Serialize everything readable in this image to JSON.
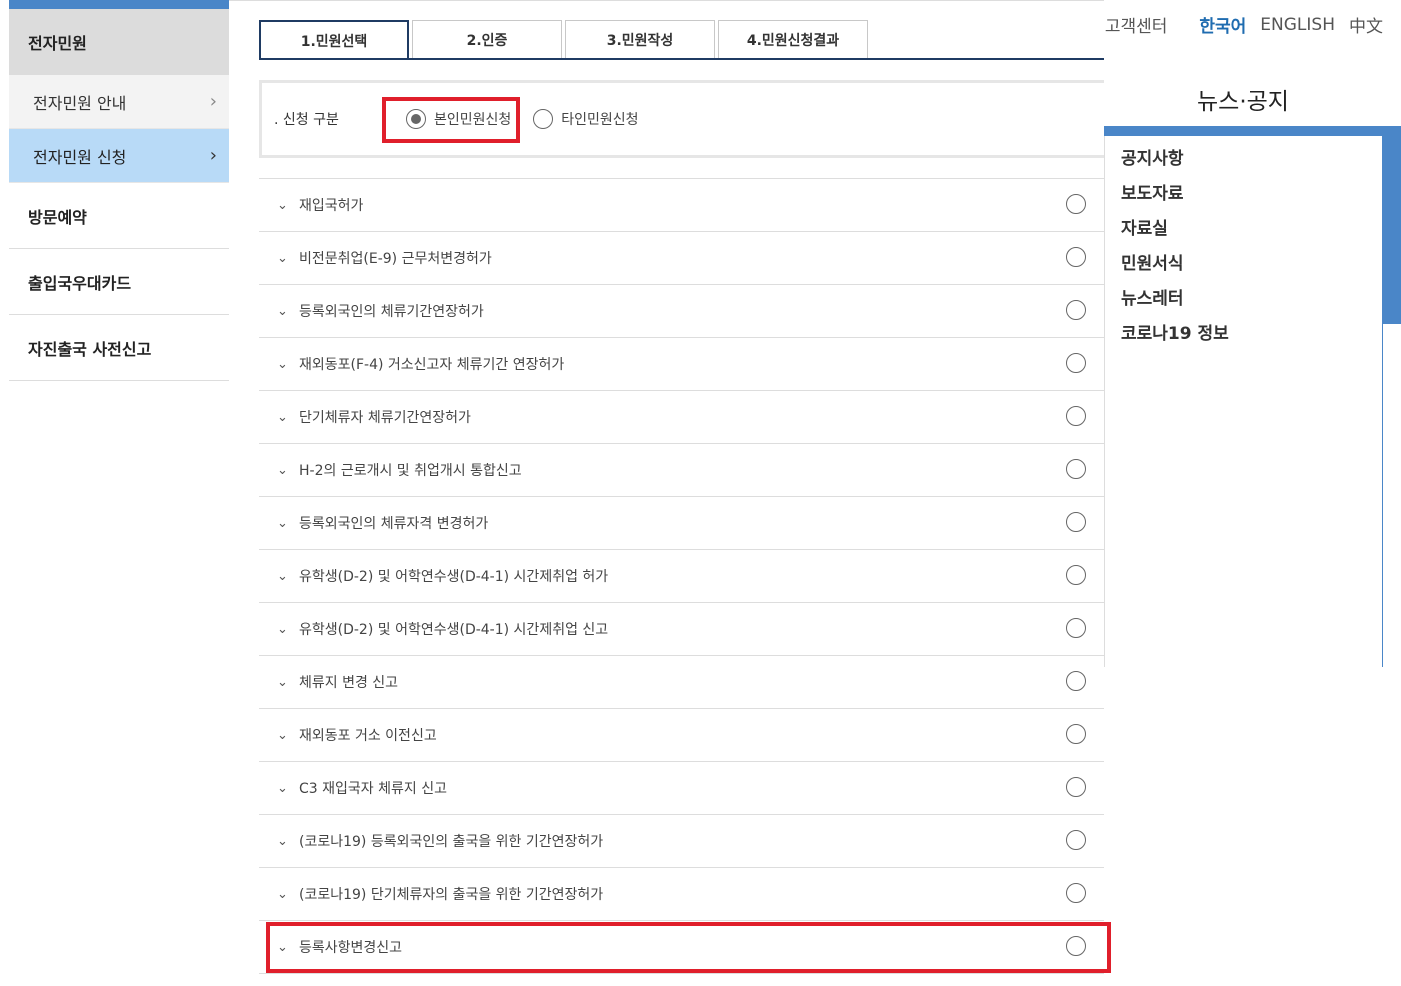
{
  "sidebar": {
    "header": "전자민원",
    "subitems": [
      {
        "label": "전자민원 안내",
        "chevron": "›"
      },
      {
        "label": "전자민원 신청",
        "chevron": "›"
      }
    ],
    "items": [
      "방문예약",
      "출입국우대카드",
      "자진출국 사전신고"
    ]
  },
  "steps": [
    "1.민원선택",
    "2.인증",
    "3.민원작성",
    "4.민원신청결과"
  ],
  "apply": {
    "label": ". 신청 구분",
    "options": [
      "본인민원신청",
      "타인민원신청"
    ],
    "selected": "본인민원신청"
  },
  "services": [
    "재입국허가",
    "비전문취업(E-9) 근무처변경허가",
    "등록외국인의 체류기간연장허가",
    "재외동포(F-4) 거소신고자 체류기간 연장허가",
    "단기체류자 체류기간연장허가",
    "H-2의 근로개시 및 취업개시 통합신고",
    "등록외국인의 체류자격 변경허가",
    "유학생(D-2) 및 어학연수생(D-4-1) 시간제취업 허가",
    "유학생(D-2) 및 어학연수생(D-4-1) 시간제취업 신고",
    "체류지 변경 신고",
    "재외동포 거소 이전신고",
    "C3 재입국자 체류지 신고",
    "(코로나19) 등록외국인의 출국을 위한 기간연장허가",
    "(코로나19) 단기체류자의 출국을 위한 기간연장허가",
    "등록사항변경신고"
  ],
  "list_arrow": "⌄",
  "util": {
    "customer_center": "고객센터",
    "lang_ko": "한국어",
    "lang_en": "ENGLISH",
    "lang_zh": "中文"
  },
  "news": {
    "title": "뉴스·공지",
    "items": [
      "공지사항",
      "보도자료",
      "자료실",
      "민원서식",
      "뉴스레터",
      "코로나19 정보"
    ]
  },
  "colors": {
    "accent": "#4a86c8",
    "highlight": "#e01f2b",
    "active_sub": "#b8daf7",
    "tab_border": "#1f3b63"
  }
}
